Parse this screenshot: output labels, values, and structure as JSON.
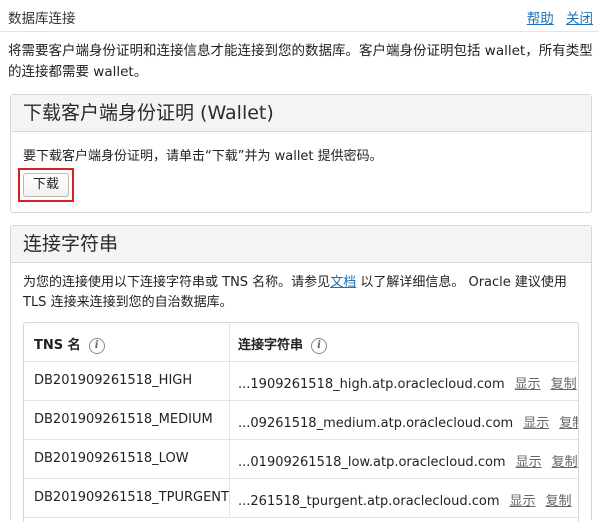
{
  "header": {
    "title": "数据库连接",
    "help_label": "帮助",
    "close_label": "关闭"
  },
  "intro": "将需要客户端身份证明和连接信息才能连接到您的数据库。客户端身份证明包括 wallet，所有类型的连接都需要 wallet。",
  "wallet_section": {
    "title": "下载客户端身份证明 (Wallet)",
    "description": "要下载客户端身份证明，请单击“下载”并为 wallet 提供密码。",
    "download_label": "下载"
  },
  "conn_section": {
    "title": "连接字符串",
    "desc_before": "为您的连接使用以下连接字符串或 TNS 名称。请参见",
    "doc_link": "文档",
    "desc_after": " 以了解详细信息。 Oracle 建议使用 TLS 连接来连接到您的自治数据库。",
    "columns": {
      "tns": "TNS 名",
      "conn": "连接字符串"
    },
    "actions": {
      "show": "显示",
      "copy": "复制"
    },
    "rows": [
      {
        "tns": "DB201909261518_HIGH",
        "conn": "...1909261518_high.atp.oraclecloud.com"
      },
      {
        "tns": "DB201909261518_MEDIUM",
        "conn": "...09261518_medium.atp.oraclecloud.com"
      },
      {
        "tns": "DB201909261518_LOW",
        "conn": "...01909261518_low.atp.oraclecloud.com"
      },
      {
        "tns": "DB201909261518_TPURGENT",
        "conn": "...261518_tpurgent.atp.oraclecloud.com"
      }
    ]
  }
}
